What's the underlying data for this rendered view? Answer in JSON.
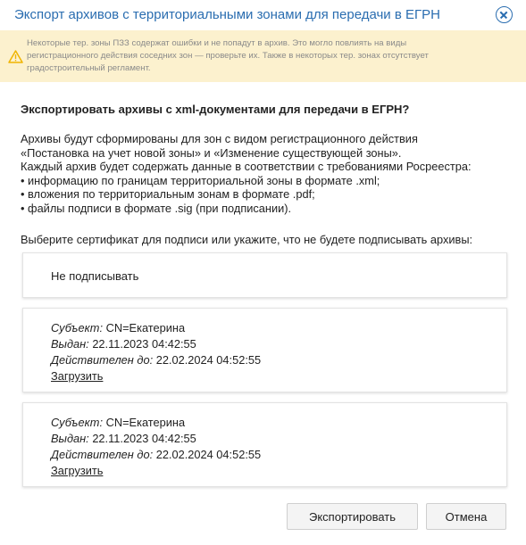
{
  "dialog": {
    "title": "Экспорт архивов с территориальными зонами для передачи в ЕГРН"
  },
  "warning": {
    "lines": [
      "Некоторые тер. зоны ПЗЗ содержат ошибки и не попадут в архив. Это могло повлиять на виды",
      "регистрационного действия соседних зон — проверьте их. Также в некоторых тер. зонах отсутствует",
      "градостроительный регламент."
    ]
  },
  "question": "Экспортировать архивы с xml-документами для передачи в ЕГРН?",
  "description": {
    "lines": [
      "Архивы будут сформированы для зон с видом регистрационного действия",
      "«Постановка на учет новой зоны» и «Изменение существующей зоны».",
      "Каждый архив будет содержать данные в соответствии с требованиями Росреестра:",
      "• информацию по границам территориальной зоны в формате .xml;",
      "• вложения по территориальным зонам в формате .pdf;",
      "• файлы подписи в формате .sig (при подписании)."
    ]
  },
  "select_prompt": "Выберите сертификат для подписи или укажите, что не будете подписывать архивы:",
  "options": {
    "no_sign": "Не подписывать",
    "certificates": [
      {
        "subject_label": "Субъект:",
        "subject": "CN=Екатерина",
        "issued_label": "Выдан:",
        "issued": "22.11.2023 04:42:55",
        "valid_label": "Действителен до:",
        "valid": "22.02.2024 04:52:55",
        "load_link": "Загрузить"
      },
      {
        "subject_label": "Субъект:",
        "subject": "CN=Екатерина",
        "issued_label": "Выдан:",
        "issued": "22.11.2023 04:42:55",
        "valid_label": "Действителен до:",
        "valid": "22.02.2024 04:52:55",
        "load_link": "Загрузить"
      }
    ]
  },
  "buttons": {
    "export": "Экспортировать",
    "cancel": "Отмена"
  },
  "icons": {
    "close": "close-circle-icon",
    "warning": "warning-triangle-icon"
  },
  "colors": {
    "title": "#2a6db0",
    "warning_bg": "#fcf1ce",
    "warning_icon": "#f0b400"
  }
}
